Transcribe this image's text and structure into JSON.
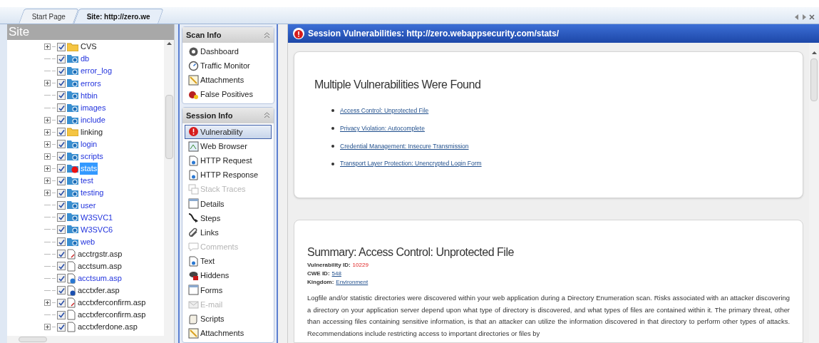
{
  "tabs": [
    {
      "label": "Start Page",
      "selected": false
    },
    {
      "label": "Site: http://zero.we",
      "selected": true
    }
  ],
  "site": {
    "title": "Site",
    "items": [
      {
        "label": "CVS",
        "kind": "folder",
        "expandable": true,
        "checked": true,
        "linked": false,
        "selected": false
      },
      {
        "label": "db",
        "kind": "web-folder",
        "expandable": false,
        "checked": true,
        "linked": true,
        "selected": false
      },
      {
        "label": "error_log",
        "kind": "web-folder",
        "expandable": false,
        "checked": true,
        "linked": true,
        "selected": false
      },
      {
        "label": "errors",
        "kind": "web-folder",
        "expandable": true,
        "checked": true,
        "linked": true,
        "selected": false
      },
      {
        "label": "htbin",
        "kind": "web-folder",
        "expandable": false,
        "checked": true,
        "linked": true,
        "selected": false
      },
      {
        "label": "images",
        "kind": "web-folder",
        "expandable": false,
        "checked": true,
        "linked": true,
        "selected": false
      },
      {
        "label": "include",
        "kind": "web-folder",
        "expandable": true,
        "checked": true,
        "linked": true,
        "selected": false
      },
      {
        "label": "linking",
        "kind": "folder",
        "expandable": true,
        "checked": true,
        "linked": false,
        "selected": false
      },
      {
        "label": "login",
        "kind": "web-folder",
        "expandable": true,
        "checked": true,
        "linked": true,
        "selected": false
      },
      {
        "label": "scripts",
        "kind": "web-folder",
        "expandable": true,
        "checked": true,
        "linked": true,
        "selected": false
      },
      {
        "label": "stats",
        "kind": "alert-folder",
        "expandable": true,
        "checked": true,
        "selected": true
      },
      {
        "label": "test",
        "kind": "web-folder",
        "expandable": true,
        "checked": true,
        "linked": true,
        "selected": false
      },
      {
        "label": "testing",
        "kind": "web-folder",
        "expandable": true,
        "checked": true,
        "linked": true,
        "selected": false
      },
      {
        "label": "user",
        "kind": "web-folder",
        "expandable": false,
        "checked": true,
        "linked": true,
        "selected": false
      },
      {
        "label": "W3SVC1",
        "kind": "web-folder",
        "expandable": false,
        "checked": true,
        "linked": true,
        "selected": false
      },
      {
        "label": "W3SVC6",
        "kind": "web-folder",
        "expandable": false,
        "checked": true,
        "linked": true,
        "selected": false
      },
      {
        "label": "web",
        "kind": "web-folder",
        "expandable": false,
        "checked": true,
        "linked": true,
        "selected": false
      },
      {
        "label": "acctrgstr.asp",
        "kind": "file-edit",
        "expandable": false,
        "checked": true,
        "linked": false,
        "selected": false
      },
      {
        "label": "acctsum.asp",
        "kind": "file",
        "expandable": false,
        "checked": true,
        "linked": false,
        "selected": false
      },
      {
        "label": "acctsum.asp",
        "kind": "file-web",
        "expandable": false,
        "checked": true,
        "linked": true,
        "selected": false
      },
      {
        "label": "acctxfer.asp",
        "kind": "file-info",
        "expandable": false,
        "checked": true,
        "linked": false,
        "selected": false
      },
      {
        "label": "acctxferconfirm.asp",
        "kind": "file-edit",
        "expandable": true,
        "checked": true,
        "linked": false,
        "selected": false
      },
      {
        "label": "acctxferconfirm.asp",
        "kind": "file",
        "expandable": false,
        "checked": true,
        "linked": false,
        "selected": false
      },
      {
        "label": "acctxferdone.asp",
        "kind": "file",
        "expandable": true,
        "checked": true,
        "linked": false,
        "selected": false
      }
    ]
  },
  "scan_info": {
    "title": "Scan Info",
    "items": [
      {
        "label": "Dashboard",
        "kind": "dashboard",
        "disabled": false,
        "selected": false
      },
      {
        "label": "Traffic Monitor",
        "kind": "gauge",
        "disabled": false,
        "selected": false
      },
      {
        "label": "Attachments",
        "kind": "note",
        "disabled": false,
        "selected": false
      },
      {
        "label": "False Positives",
        "kind": "bug",
        "disabled": false,
        "selected": false
      }
    ]
  },
  "session_info": {
    "title": "Session Info",
    "items": [
      {
        "label": "Vulnerability",
        "kind": "alert",
        "disabled": false,
        "selected": true
      },
      {
        "label": "Web Browser",
        "kind": "browser",
        "disabled": false,
        "selected": false
      },
      {
        "label": "HTTP Request",
        "kind": "doc",
        "disabled": false,
        "selected": false
      },
      {
        "label": "HTTP Response",
        "kind": "doc",
        "disabled": false,
        "selected": false
      },
      {
        "label": "Stack Traces",
        "kind": "stack",
        "disabled": true,
        "selected": false
      },
      {
        "label": "Details",
        "kind": "window",
        "disabled": false,
        "selected": false
      },
      {
        "label": "Steps",
        "kind": "arrow",
        "disabled": false,
        "selected": false
      },
      {
        "label": "Links",
        "kind": "link",
        "disabled": false,
        "selected": false
      },
      {
        "label": "Comments",
        "kind": "comment",
        "disabled": true,
        "selected": false
      },
      {
        "label": "Text",
        "kind": "doc",
        "disabled": false,
        "selected": false
      },
      {
        "label": "Hiddens",
        "kind": "eye",
        "disabled": false,
        "selected": false
      },
      {
        "label": "Forms",
        "kind": "window",
        "disabled": false,
        "selected": false
      },
      {
        "label": "E-mail",
        "kind": "mail",
        "disabled": true,
        "selected": false
      },
      {
        "label": "Scripts",
        "kind": "scroll",
        "disabled": false,
        "selected": false
      },
      {
        "label": "Attachments",
        "kind": "note",
        "disabled": false,
        "selected": false
      }
    ]
  },
  "content": {
    "title": "Session Vulnerabilities: http://zero.webappsecurity.com/stats/",
    "heading": "Multiple Vulnerabilities Were Found",
    "links": [
      "Access Control: Unprotected File",
      "Privacy Violation: Autocomplete",
      "Credential Management: Insecure Transmission",
      "Transport Layer Protection: Unencrypted Login Form"
    ],
    "summary": {
      "heading": "Summary: Access Control: Unprotected File",
      "fields": [
        {
          "label": "Vulnerability ID:",
          "value": "10229",
          "kind": "alert"
        },
        {
          "label": "CWE ID:",
          "value": "548",
          "kind": "link"
        },
        {
          "label": "Kingdom:",
          "value": "Environment",
          "kind": "link"
        }
      ],
      "description": "Logfile and/or statistic directories were discovered within your web application during a Directory Enumeration scan. Risks associated with an attacker discovering a directory on your application server depend upon what type of directory is discovered, and what types of files are contained within it. The primary threat, other than accessing files containing sensitive information, is that an attacker can utilize the information discovered in that directory to perform other types of attacks. Recommendations include restricting access to important directories or files by"
    }
  }
}
